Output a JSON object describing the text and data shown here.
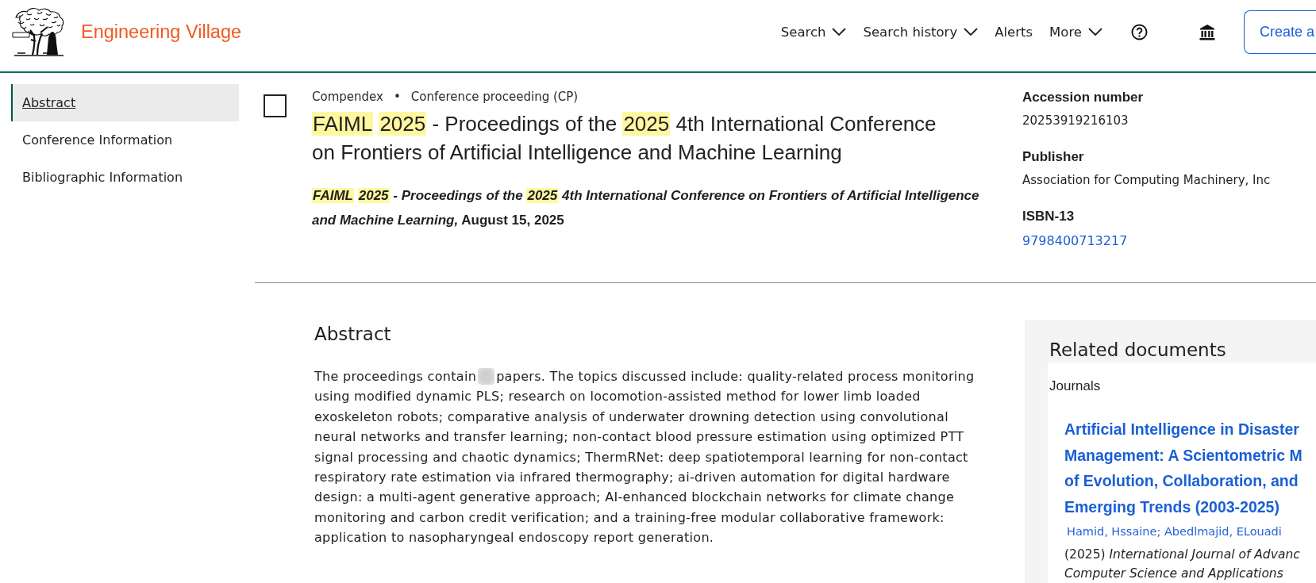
{
  "header": {
    "site_name": "Engineering Village",
    "nav": [
      {
        "label": "Search",
        "kind": "dropdown"
      },
      {
        "label": "Search history",
        "kind": "dropdown"
      },
      {
        "label": "Alerts",
        "kind": "link"
      },
      {
        "label": "More",
        "kind": "dropdown"
      }
    ],
    "button_label": "Create a"
  },
  "sidebar": {
    "items": [
      {
        "label": "Abstract",
        "selected": true
      },
      {
        "label": "Conference Information",
        "selected": false
      },
      {
        "label": "Bibliographic Information",
        "selected": false
      }
    ]
  },
  "record": {
    "checked": false,
    "database": "Compendex",
    "separator": "•",
    "doc_type": "Conference proceeding (CP)",
    "title": [
      {
        "text": "FAIML",
        "highlighted": true
      },
      {
        "text": "2025",
        "highlighted": true
      },
      {
        "text": "- Proceedings of the",
        "highlighted": false
      },
      {
        "text": "2025",
        "highlighted": true
      },
      {
        "text": "4th International Conference on Frontiers of Artificial Intelligence and Machine Learning",
        "highlighted": false
      }
    ],
    "citation": {
      "segments": [
        {
          "text": "FAIML",
          "highlighted": true
        },
        {
          "text": "2025",
          "highlighted": true
        },
        {
          "text": "- Proceedings of the",
          "highlighted": false
        },
        {
          "text": "2025",
          "highlighted": true
        },
        {
          "text": "4th International Conference on Frontiers of Artificial Intelligence and Machine Learning,",
          "highlighted": false
        }
      ],
      "date": "August 15, 2025"
    },
    "details": [
      {
        "label": "Accession number",
        "value": "20253919216103",
        "kind": "text"
      },
      {
        "label": "Publisher",
        "value": "Association for Computing Machinery, Inc",
        "kind": "text"
      },
      {
        "label": "ISBN-13",
        "value": "9798400713217",
        "kind": "link"
      }
    ]
  },
  "abstract": {
    "heading": "Abstract",
    "text_before": "The proceedings contain",
    "blurred": true,
    "text_after": "papers. The topics discussed include: quality-related process monitoring using modified dynamic PLS; research on locomotion-assisted method for lower limb loaded exoskeleton robots; comparative analysis of underwater drowning detection using convolutional neural networks and transfer learning; non-contact blood pressure estimation using optimized PTT signal processing and chaotic dynamics; ThermRNet: deep spatiotemporal learning for non-contact respiratory rate estimation via infrared thermography; ai-driven automation for digital hardware design: a multi-agent generative approach; AI-enhanced blockchain networks for climate change monitoring and carbon credit verification; and a training-free modular collaborative framework: application to nasopharyngeal endoscopy report generation."
  },
  "related": {
    "heading": "Related documents",
    "group": "Journals",
    "items": [
      {
        "title_lines": [
          "Artificial Intelligence in Disaster",
          "Management: A Scientometric M",
          "of Evolution, Collaboration, and",
          "Emerging Trends (2003-2025)"
        ],
        "authors": "Hamid, Hssaine; Abedlmajid, ELouadi",
        "year": "(2025)",
        "journal_lines": [
          "International Journal of Advanc",
          "Computer Science and Applications"
        ]
      }
    ]
  }
}
